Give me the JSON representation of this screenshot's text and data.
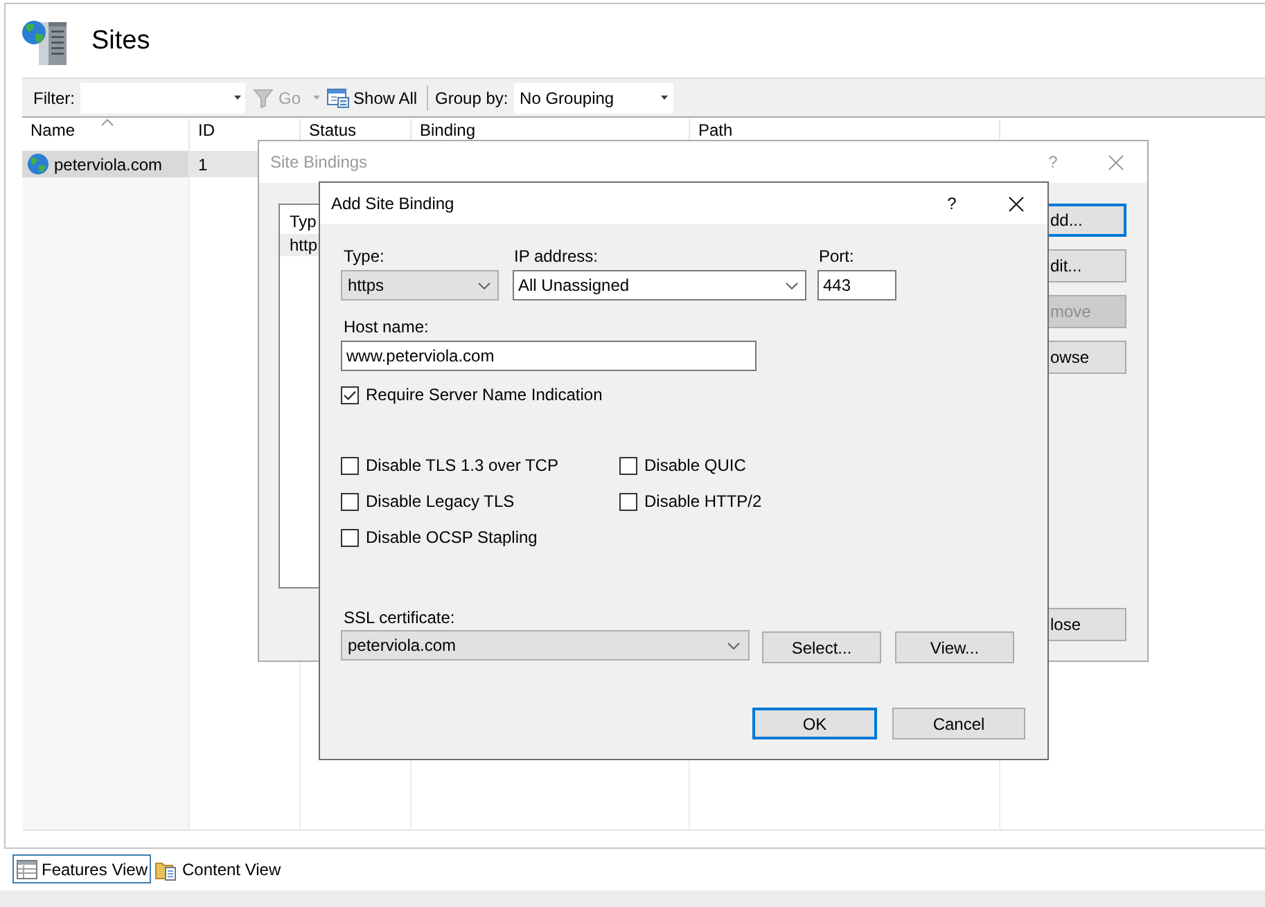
{
  "window": {
    "title": "Sites"
  },
  "toolbar": {
    "filter": {
      "label": "Filter:"
    },
    "go": {
      "label": "Go",
      "disabled": true
    },
    "show_all": {
      "label": "Show All"
    },
    "group_by": {
      "label": "Group by:",
      "value": "No Grouping"
    }
  },
  "table": {
    "columns": [
      {
        "label": "Name",
        "sorted": true
      },
      {
        "label": "ID",
        "sorted": false
      },
      {
        "label": "Status",
        "sorted": false
      },
      {
        "label": "Binding",
        "sorted": false
      },
      {
        "label": "Path",
        "sorted": false
      }
    ],
    "rows": [
      {
        "selected": true,
        "cells": [
          "peterviola.com",
          "1"
        ]
      }
    ]
  },
  "site_bindings_dialog": {
    "title": "Site Bindings",
    "active": false,
    "help": "?",
    "list": {
      "column": "Typ",
      "rows": [
        {
          "selected": true,
          "cells": [
            "http"
          ]
        }
      ]
    },
    "buttons": [
      {
        "label": "dd...",
        "focused": true,
        "disabled": false
      },
      {
        "label": "dit...",
        "focused": false,
        "disabled": false
      },
      {
        "label": "move",
        "focused": false,
        "disabled": true
      },
      {
        "label": "owse",
        "focused": false,
        "disabled": false
      },
      {
        "label": "lose",
        "focused": false,
        "disabled": false
      }
    ]
  },
  "add_site_binding_dialog": {
    "title": "Add Site Binding",
    "active": true,
    "help": "?",
    "type": {
      "label": "Type:",
      "value": "https"
    },
    "ip_address": {
      "label": "IP address:",
      "value": "All Unassigned"
    },
    "port": {
      "label": "Port:",
      "value": "443"
    },
    "host_name": {
      "label": "Host name:",
      "value": "www.peterviola.com"
    },
    "require_sni": {
      "label": "Require Server Name Indication",
      "checked": true
    },
    "options": [
      {
        "label": "Disable TLS 1.3 over TCP",
        "checked": false
      },
      {
        "label": "Disable QUIC",
        "checked": false
      },
      {
        "label": "Disable Legacy TLS",
        "checked": false
      },
      {
        "label": "Disable HTTP/2",
        "checked": false
      },
      {
        "label": "Disable OCSP Stapling",
        "checked": false
      }
    ],
    "ssl_certificate": {
      "label": "SSL certificate:",
      "value": "peterviola.com"
    },
    "certificate_buttons": [
      {
        "label": "Select...",
        "focused": false
      },
      {
        "label": "View...",
        "focused": false
      }
    ],
    "footer_buttons": [
      {
        "label": "OK",
        "focused": true
      },
      {
        "label": "Cancel",
        "focused": false
      }
    ]
  },
  "view_tabs": [
    {
      "kind": "features",
      "label": "Features View",
      "selected": true
    },
    {
      "kind": "content",
      "label": "Content View",
      "selected": false
    }
  ]
}
